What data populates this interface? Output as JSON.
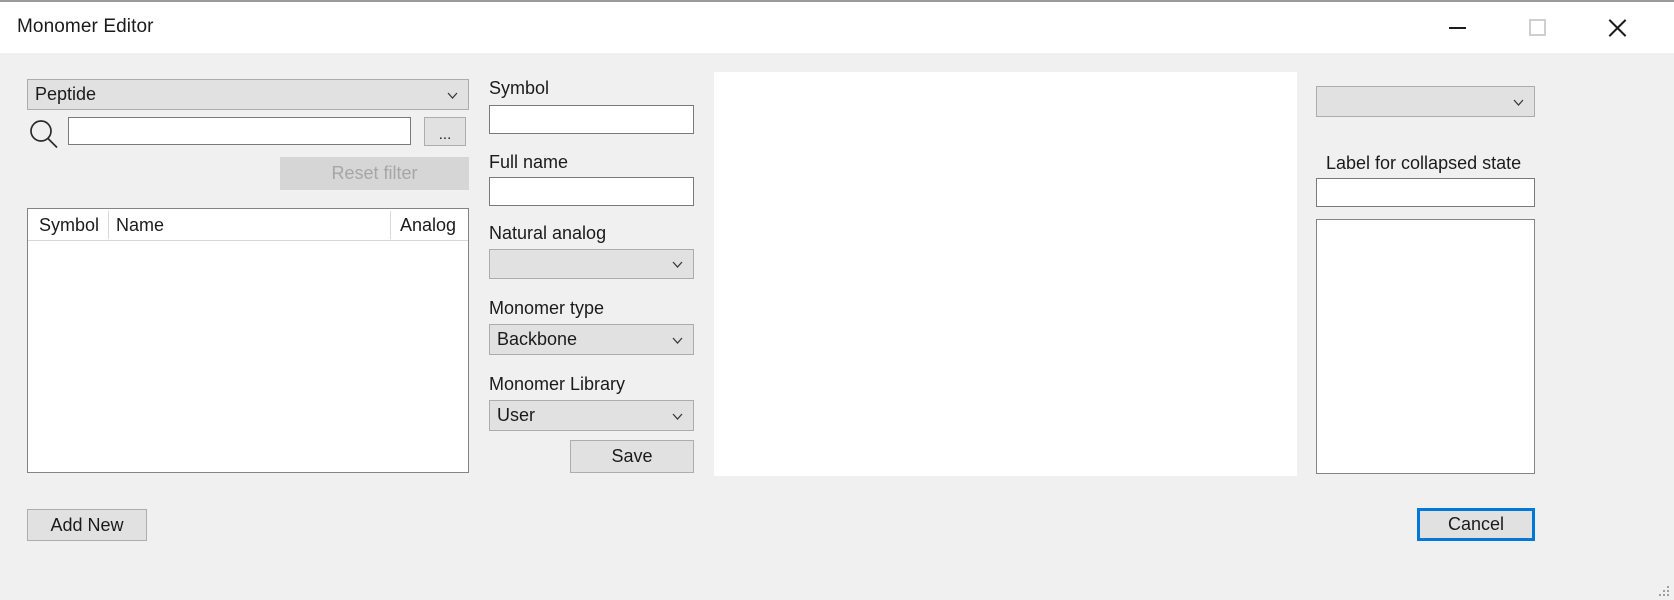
{
  "window": {
    "title": "Monomer Editor",
    "controls": {
      "minimize": "minimize-icon",
      "maximize": "maximize-icon",
      "close": "close-icon"
    }
  },
  "left_panel": {
    "polymer_type_combo": {
      "value": "Peptide",
      "options": [
        "Peptide"
      ]
    },
    "search": {
      "icon": "search-icon",
      "value": "",
      "placeholder": ""
    },
    "browse_button": "...",
    "reset_filter_button": "Reset filter",
    "table": {
      "columns": [
        "Symbol",
        "Name",
        "Analog"
      ],
      "rows": []
    },
    "add_new_button": "Add New"
  },
  "form": {
    "symbol": {
      "label": "Symbol",
      "value": "",
      "placeholder": ""
    },
    "full_name": {
      "label": "Full name",
      "value": "",
      "placeholder": ""
    },
    "natural_analog": {
      "label": "Natural analog",
      "value": "",
      "options": []
    },
    "monomer_type": {
      "label": "Monomer type",
      "value": "Backbone",
      "options": [
        "Backbone"
      ]
    },
    "monomer_library": {
      "label": "Monomer Library",
      "value": "User",
      "options": [
        "User"
      ]
    },
    "save_button": "Save"
  },
  "right_panel": {
    "attachment_combo": {
      "value": "",
      "options": []
    },
    "collapsed_label": {
      "label": "Label for collapsed state",
      "value": "",
      "placeholder": ""
    },
    "list_items": []
  },
  "footer": {
    "cancel_button": "Cancel",
    "resize_grip": "resize-grip-icon"
  },
  "colors": {
    "window_bg": "#f0f0f0",
    "field_bg": "#ffffff",
    "control_bg": "#e1e1e1",
    "focus_accent": "#0078d7",
    "text": "#1b1b1b",
    "disabled_text": "#a6a6a6"
  }
}
